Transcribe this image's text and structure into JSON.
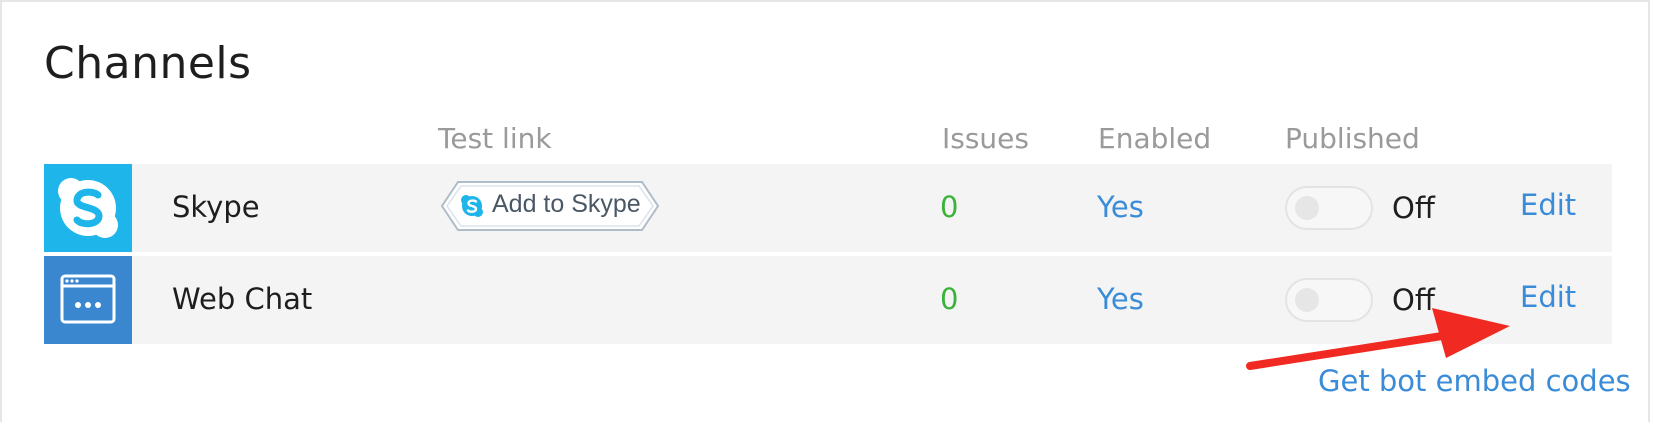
{
  "title": "Channels",
  "columns": {
    "test_link": "Test link",
    "issues": "Issues",
    "enabled": "Enabled",
    "published": "Published"
  },
  "channels": [
    {
      "name": "Skype",
      "icon": "skype-icon",
      "icon_color": "#1db5ea",
      "test_link_label": "Add to Skype",
      "issues": "0",
      "enabled": "Yes",
      "published": "Off",
      "published_on": false,
      "edit_label": "Edit"
    },
    {
      "name": "Web Chat",
      "icon": "web-chat-icon",
      "icon_color": "#3a87d0",
      "issues": "0",
      "enabled": "Yes",
      "published": "Off",
      "published_on": false,
      "edit_label": "Edit"
    }
  ],
  "embed_link": "Get bot embed codes",
  "colors": {
    "link": "#3a8cd8",
    "issues": "#3bb33b",
    "annotation_arrow": "#f02a22"
  }
}
